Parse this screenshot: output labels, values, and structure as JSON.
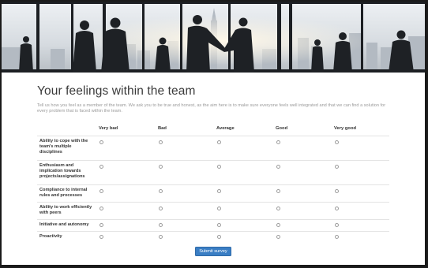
{
  "page": {
    "title": "Your feelings within the team",
    "intro": "Tell us how you feel as a member of the team. We ask you to be true and honest, as the aim here is to make sure everyone feels well integrated and that we can find a solution for every problem that is faced within the team."
  },
  "scale": {
    "columns": [
      "Very bad",
      "Bad",
      "Average",
      "Good",
      "Very good"
    ]
  },
  "questions": [
    {
      "label": "Ability to cope with the team's multiple disciplines"
    },
    {
      "label": "Enthusiasm and implication towards projects/assignations"
    },
    {
      "label": "Compliance to internal rules and processes"
    },
    {
      "label": "Ability to work efficiently with peers"
    },
    {
      "label": "Initiative and autonomy"
    },
    {
      "label": "Proactivity"
    }
  ],
  "submit": {
    "label": "Submit survey"
  },
  "colors": {
    "accent": "#3a7ec4",
    "title_text": "#3a3a3a",
    "intro_text": "#9a9a9a",
    "row_border": "#e4e4e4"
  }
}
